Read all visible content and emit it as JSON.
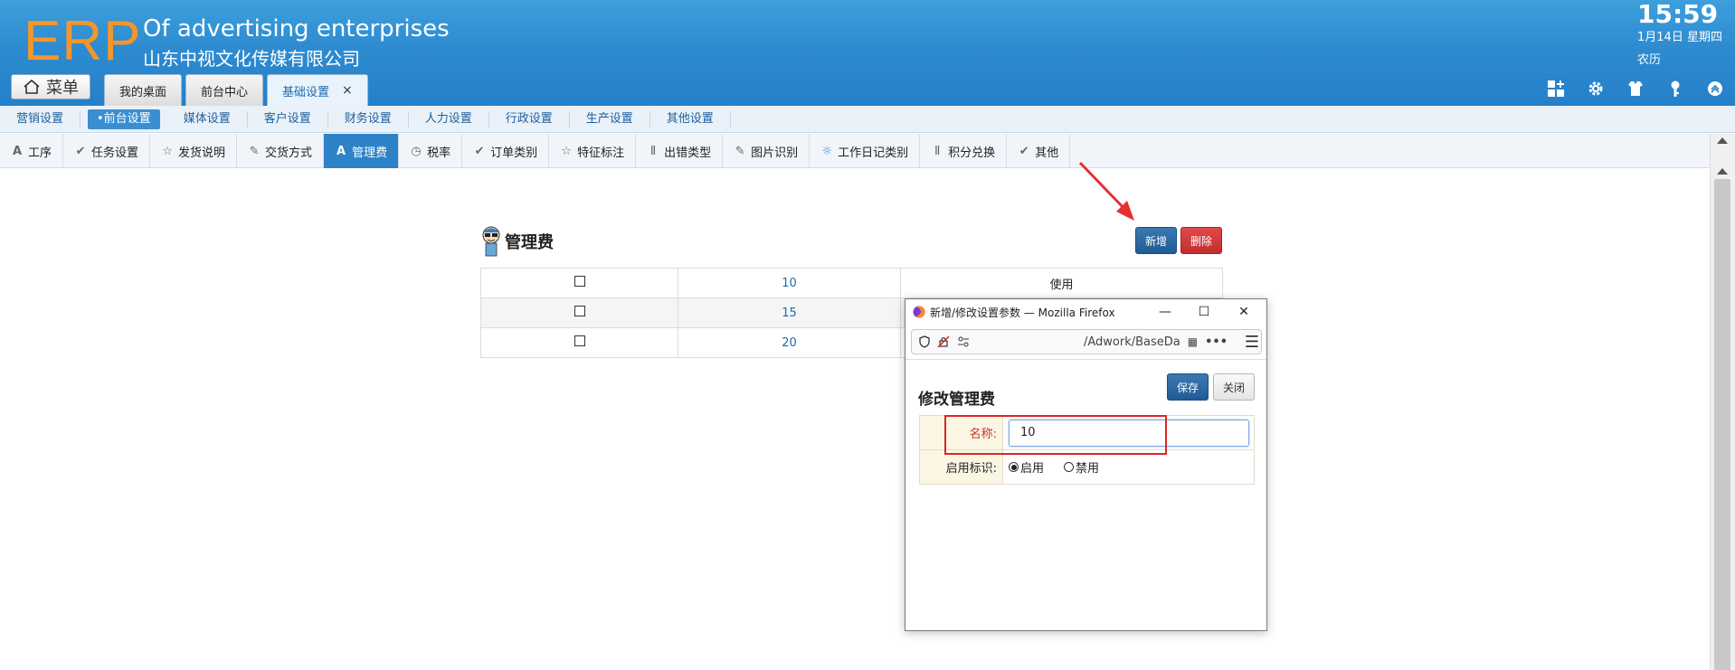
{
  "header": {
    "logo": "ERP",
    "company_en": "Of advertising enterprises",
    "company_cn": "山东中视文化传媒有限公司",
    "time": "15:59",
    "date": "1月14日 星期四",
    "lunar": "农历"
  },
  "menu_button": {
    "label": "菜单"
  },
  "top_tabs": [
    {
      "label": "我的桌面"
    },
    {
      "label": "前台中心"
    },
    {
      "label": "基础设置",
      "close": "×"
    }
  ],
  "subnav": [
    {
      "label": "营销设置"
    },
    {
      "label": "•前台设置"
    },
    {
      "label": "媒体设置"
    },
    {
      "label": "客户设置"
    },
    {
      "label": "财务设置"
    },
    {
      "label": "人力设置"
    },
    {
      "label": "行政设置"
    },
    {
      "label": "生产设置"
    },
    {
      "label": "其他设置"
    }
  ],
  "tabs": [
    {
      "label": "工序",
      "icon": "font-icon"
    },
    {
      "label": "任务设置",
      "icon": "check-icon"
    },
    {
      "label": "发货说明",
      "icon": "star-icon"
    },
    {
      "label": "交货方式",
      "icon": "pencil-icon"
    },
    {
      "label": "管理费",
      "icon": "font-icon"
    },
    {
      "label": "税率",
      "icon": "clock-icon"
    },
    {
      "label": "订单类别",
      "icon": "check-icon"
    },
    {
      "label": "特征标注",
      "icon": "star-icon"
    },
    {
      "label": "出错类型",
      "icon": "pause-icon"
    },
    {
      "label": "图片识别",
      "icon": "pencil-icon"
    },
    {
      "label": "工作日记类别",
      "icon": "sun-icon"
    },
    {
      "label": "积分兑换",
      "icon": "pause-icon"
    },
    {
      "label": "其他",
      "icon": "check-icon"
    }
  ],
  "content": {
    "title": "管理费",
    "add_label": "新增",
    "delete_label": "删除",
    "rows": [
      {
        "value": "10",
        "status": "使用"
      },
      {
        "value": "15",
        "status": ""
      },
      {
        "value": "20",
        "status": ""
      }
    ]
  },
  "popup": {
    "window_title": "新增/修改设置参数 — Mozilla Firefox",
    "url": "/Adwork/BaseDa",
    "heading": "修改管理费",
    "save_label": "保存",
    "close_label": "关闭",
    "name_label": "名称:",
    "name_value": "10",
    "flag_label": "启用标识:",
    "enable_label": "启用",
    "disable_label": "禁用"
  },
  "colors": {
    "header_blue": "#2e8bd0",
    "accent_orange": "#f5962a",
    "active_tab": "#2e82c8",
    "danger": "#c22d2d"
  }
}
